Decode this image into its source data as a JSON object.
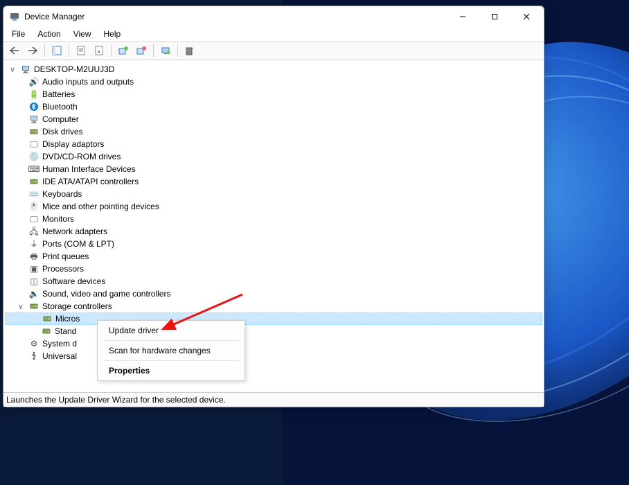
{
  "titlebar": {
    "title": "Device Manager"
  },
  "menubar": {
    "items": [
      "File",
      "Action",
      "View",
      "Help"
    ]
  },
  "toolbar": {
    "icons": [
      "back-icon",
      "forward-icon",
      "sep",
      "up-folder-icon",
      "sep",
      "properties-icon",
      "refresh-icon",
      "sep",
      "list-icon",
      "details-icon",
      "sep",
      "scan-hardware-icon",
      "sep",
      "monitor-icon",
      "sep",
      "device-icon"
    ]
  },
  "tree": {
    "root": {
      "icon": "computer-icon",
      "label": "DESKTOP-M2UUJ3D",
      "expanded": true,
      "children": [
        {
          "icon": "audio-icon",
          "label": "Audio inputs and outputs"
        },
        {
          "icon": "battery-icon",
          "label": "Batteries"
        },
        {
          "icon": "bluetooth-icon",
          "label": "Bluetooth"
        },
        {
          "icon": "computer-icon",
          "label": "Computer"
        },
        {
          "icon": "disk-icon",
          "label": "Disk drives"
        },
        {
          "icon": "display-icon",
          "label": "Display adaptors"
        },
        {
          "icon": "dvd-icon",
          "label": "DVD/CD-ROM drives"
        },
        {
          "icon": "hid-icon",
          "label": "Human Interface Devices"
        },
        {
          "icon": "ide-icon",
          "label": "IDE ATA/ATAPI controllers"
        },
        {
          "icon": "keyboard-icon",
          "label": "Keyboards"
        },
        {
          "icon": "mouse-icon",
          "label": "Mice and other pointing devices"
        },
        {
          "icon": "monitor-icon",
          "label": "Monitors"
        },
        {
          "icon": "network-icon",
          "label": "Network adapters"
        },
        {
          "icon": "ports-icon",
          "label": "Ports (COM & LPT)"
        },
        {
          "icon": "printer-icon",
          "label": "Print queues"
        },
        {
          "icon": "processor-icon",
          "label": "Processors"
        },
        {
          "icon": "software-icon",
          "label": "Software devices"
        },
        {
          "icon": "sound-icon",
          "label": "Sound, video and game controllers"
        },
        {
          "icon": "storage-icon",
          "label": "Storage controllers",
          "expanded": true,
          "children": [
            {
              "icon": "storage-device-icon",
              "label": "Microsoft Storage Spaces Controller",
              "selected": true
            },
            {
              "icon": "storage-device-icon",
              "label": "Standard SATA AHCI Controller"
            }
          ]
        },
        {
          "icon": "system-icon",
          "label": "System devices"
        },
        {
          "icon": "usb-icon",
          "label": "Universal Serial Bus controllers"
        }
      ]
    }
  },
  "context_menu": {
    "items": [
      {
        "label": "Update driver"
      },
      {
        "sep": true
      },
      {
        "label": "Scan for hardware changes"
      },
      {
        "sep": true
      },
      {
        "label": "Properties",
        "bold": true
      }
    ]
  },
  "statusbar": {
    "text": "Launches the Update Driver Wizard for the selected device."
  },
  "icons": {
    "computer-icon": "🖥️",
    "audio-icon": "🔊",
    "battery-icon": "🔋",
    "bluetooth-icon": "ᛒ",
    "disk-icon": "💽",
    "display-icon": "🖵",
    "dvd-icon": "💿",
    "hid-icon": "⌨",
    "ide-icon": "🖴",
    "keyboard-icon": "⌨️",
    "mouse-icon": "🖱️",
    "monitor-icon": "🖵",
    "network-icon": "🖧",
    "ports-icon": "⏚",
    "printer-icon": "🖶",
    "processor-icon": "▣",
    "software-icon": "◫",
    "sound-icon": "🔈",
    "storage-icon": "🖴",
    "storage-device-icon": "🖴",
    "system-icon": "⚙",
    "usb-icon": "⌁"
  }
}
